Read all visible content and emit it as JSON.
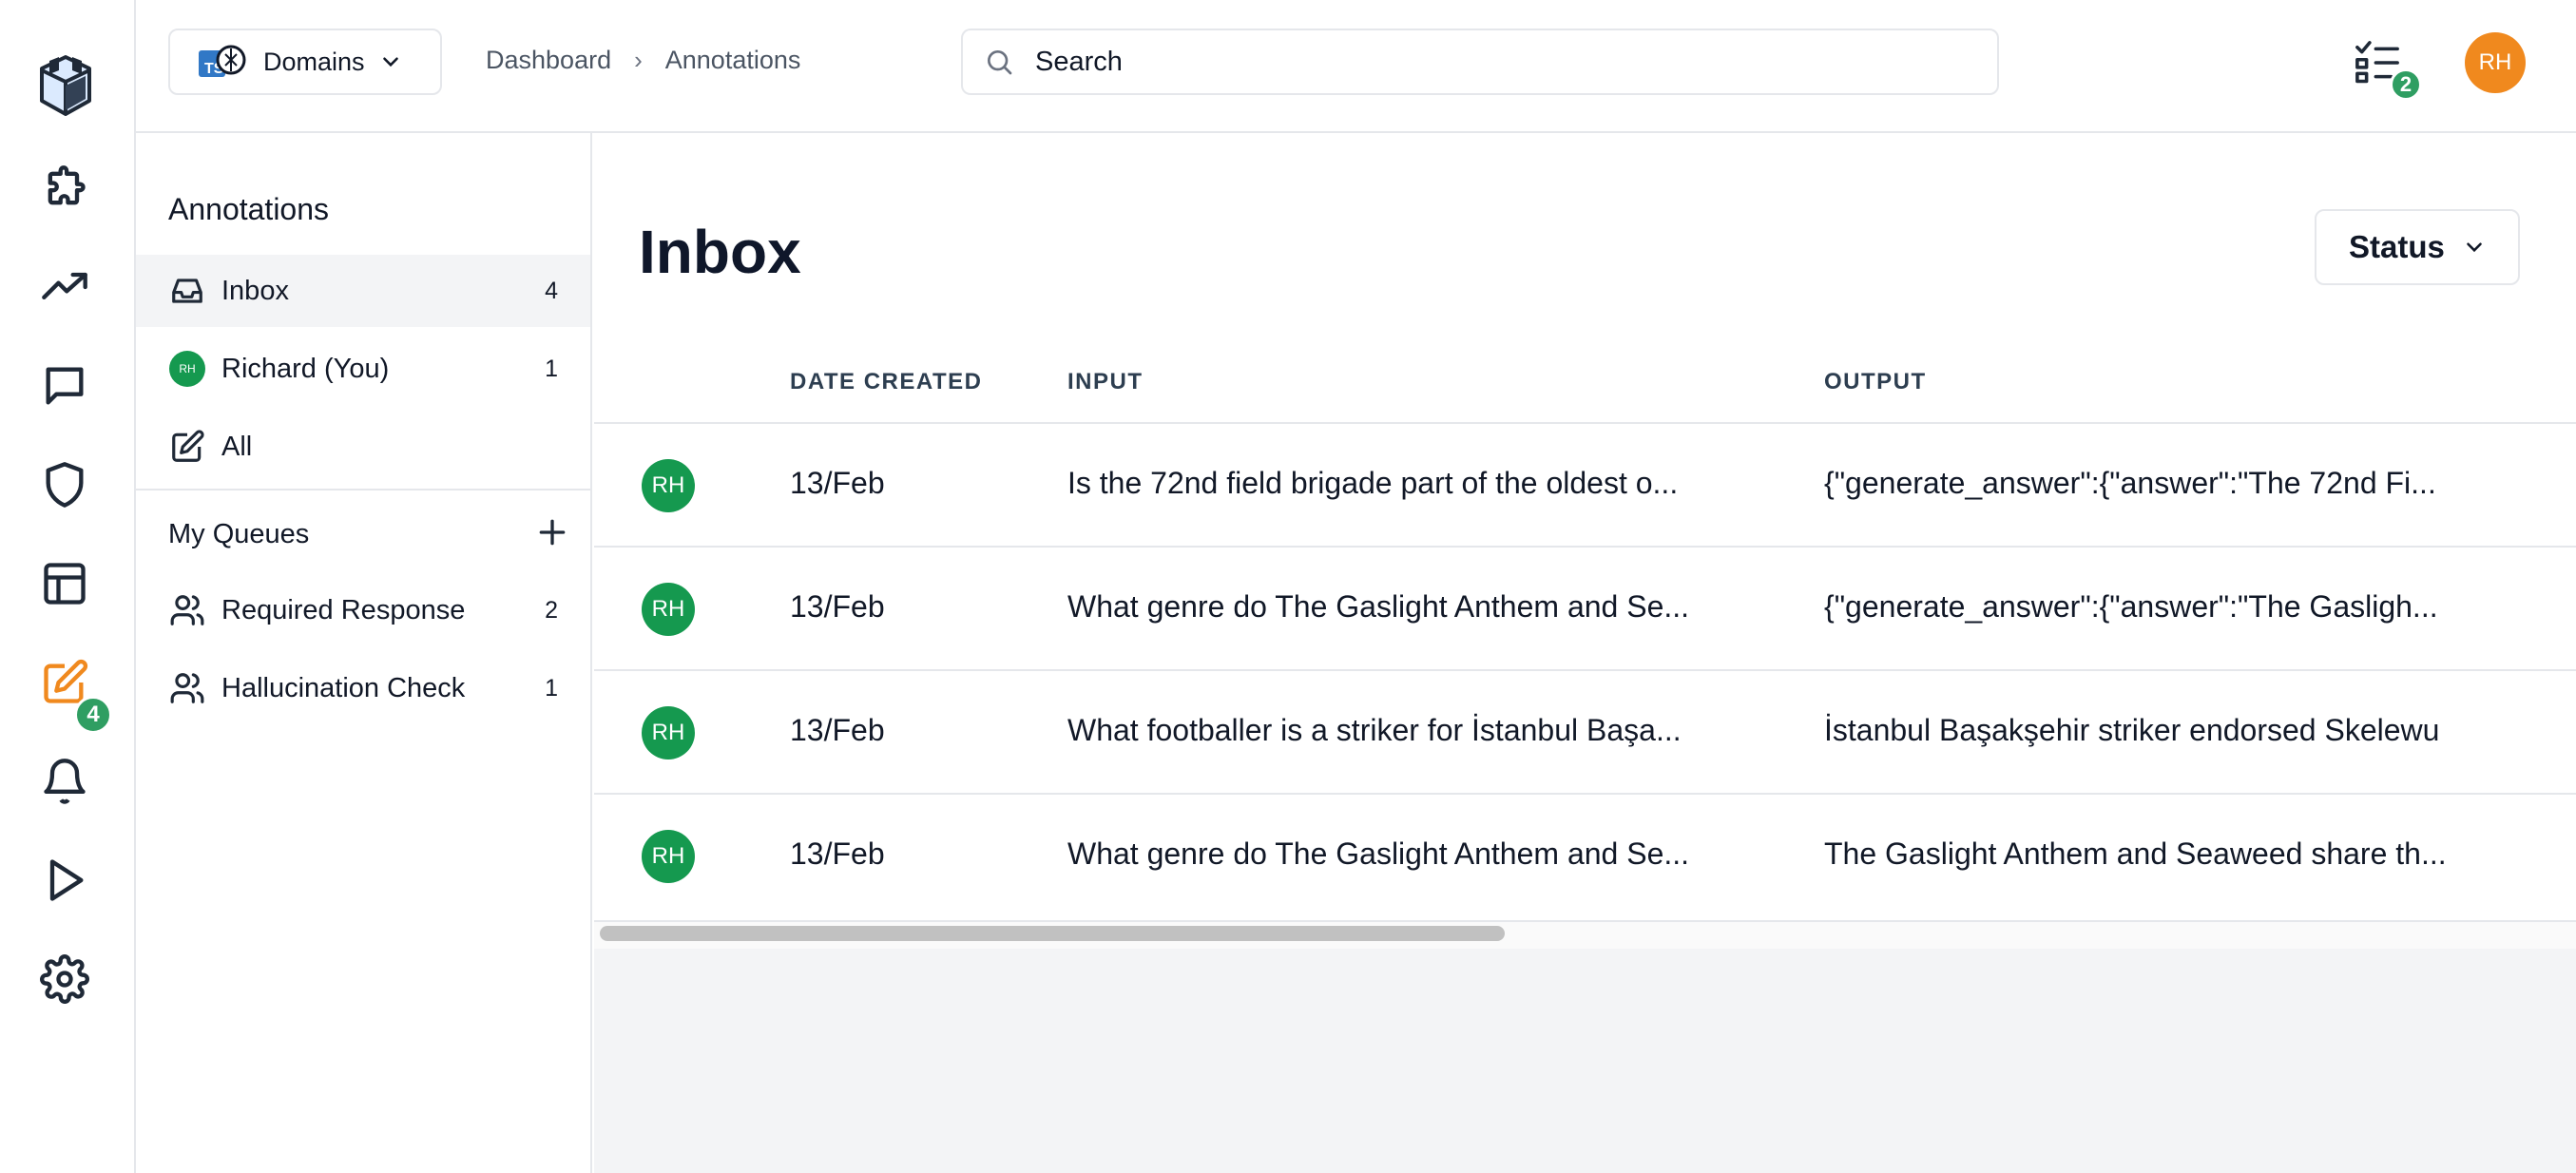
{
  "rail": {
    "badge": "4",
    "items": [
      "puzzle-icon",
      "trend-icon",
      "chat-icon",
      "shield-icon",
      "table-icon",
      "annotate-icon",
      "bell-icon",
      "play-icon",
      "gear-icon"
    ]
  },
  "topbar": {
    "domains_label": "Domains",
    "breadcrumb": [
      "Dashboard",
      "Annotations"
    ],
    "search_placeholder": "Search",
    "tasks_badge": "2",
    "user_initials": "RH"
  },
  "sidebar": {
    "title": "Annotations",
    "items": [
      {
        "label": "Inbox",
        "count": "4"
      },
      {
        "label": "Richard (You)",
        "count": "1",
        "initials": "RH"
      },
      {
        "label": "All",
        "count": ""
      }
    ],
    "queues_title": "My Queues",
    "queues": [
      {
        "label": "Required Response",
        "count": "2"
      },
      {
        "label": "Hallucination Check",
        "count": "1"
      }
    ]
  },
  "main": {
    "title": "Inbox",
    "status_label": "Status",
    "columns": [
      "DATE CREATED",
      "INPUT",
      "OUTPUT"
    ],
    "rows": [
      {
        "initials": "RH",
        "date": "13/Feb",
        "input": "Is the 72nd field brigade part of the oldest o...",
        "output": "{\"generate_answer\":{\"answer\":\"The 72nd Fi..."
      },
      {
        "initials": "RH",
        "date": "13/Feb",
        "input": "What genre do The Gaslight Anthem and Se...",
        "output": "{\"generate_answer\":{\"answer\":\"The Gasligh..."
      },
      {
        "initials": "RH",
        "date": "13/Feb",
        "input": "What footballer is a striker for İstanbul Başa...",
        "output": "İstanbul Başakşehir striker endorsed Skelewu"
      },
      {
        "initials": "RH",
        "date": "13/Feb",
        "input": "What genre do The Gaslight Anthem and Se...",
        "output": "The Gaslight Anthem and Seaweed share th..."
      }
    ]
  },
  "colors": {
    "accent_green": "#15994f",
    "badge_green": "#2f9e62",
    "avatar_orange": "#f0891e",
    "active_icon": "#f0891e"
  }
}
